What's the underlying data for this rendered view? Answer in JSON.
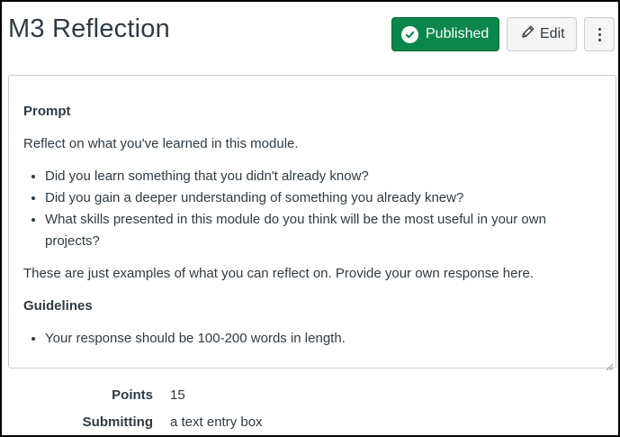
{
  "page": {
    "title": "M3 Reflection"
  },
  "header": {
    "published_label": "Published",
    "edit_label": "Edit",
    "more_icon": "kebab-menu-icon"
  },
  "description": {
    "prompt_heading": "Prompt",
    "intro": "Reflect on what you've learned in this module.",
    "questions": [
      "Did you learn something that you didn't already know?",
      "Did you gain a deeper understanding of something you already knew?",
      "What skills presented in this module do you think will be the most useful in your own projects?"
    ],
    "closing": "These are just examples of what you can reflect on. Provide your own response here.",
    "guidelines_heading": "Guidelines",
    "guidelines": [
      "Your response should be 100-200 words in length."
    ]
  },
  "details": {
    "points_label": "Points",
    "points_value": "15",
    "submitting_label": "Submitting",
    "submitting_value": "a text entry box"
  },
  "colors": {
    "published_green": "#0b874b",
    "text": "#2d3b45",
    "border": "#c7cdd1"
  }
}
